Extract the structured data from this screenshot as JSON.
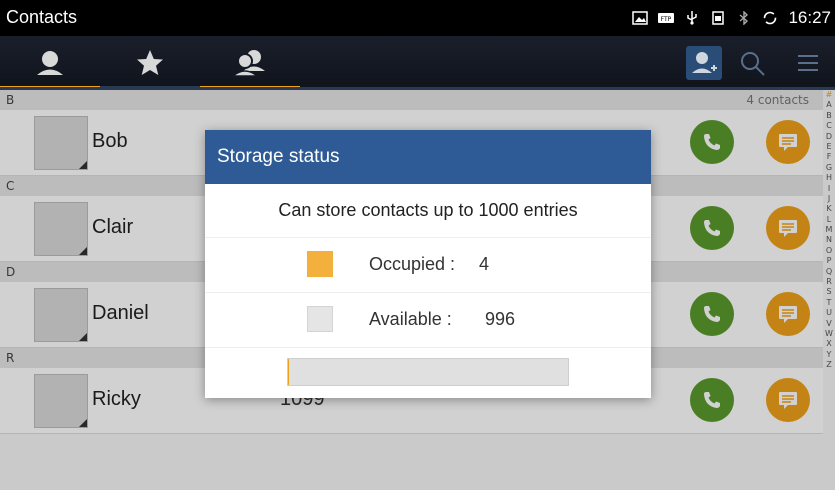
{
  "statusbar": {
    "app_title": "Contacts",
    "time": "16:27",
    "icons": [
      "image-icon",
      "ftp-icon",
      "usb-icon",
      "sim-icon",
      "bluetooth-icon",
      "sync-icon"
    ]
  },
  "tabs": [
    {
      "icon": "person-icon",
      "active": true
    },
    {
      "icon": "star-icon",
      "active": false
    },
    {
      "icon": "group-icon",
      "active": false
    }
  ],
  "toolbar_actions": [
    "add-contact-icon",
    "search-icon",
    "menu-icon"
  ],
  "contacts": {
    "count_label": "4 contacts",
    "sections": [
      {
        "letter": "B",
        "items": [
          {
            "name": "Bob",
            "number": ""
          }
        ]
      },
      {
        "letter": "C",
        "items": [
          {
            "name": "Clair",
            "number": ""
          }
        ]
      },
      {
        "letter": "D",
        "items": [
          {
            "name": "Daniel",
            "number": ""
          }
        ]
      },
      {
        "letter": "R",
        "items": [
          {
            "name": "Ricky",
            "number": "1099"
          }
        ]
      }
    ]
  },
  "alphabet": [
    "#",
    "A",
    "B",
    "C",
    "D",
    "E",
    "F",
    "G",
    "H",
    "I",
    "J",
    "K",
    "L",
    "M",
    "N",
    "O",
    "P",
    "Q",
    "R",
    "S",
    "T",
    "U",
    "V",
    "W",
    "X",
    "Y",
    "Z"
  ],
  "dialog": {
    "title": "Storage status",
    "message": "Can store contacts up to 1000 entries",
    "occupied_label": "Occupied :",
    "occupied_value": "4",
    "available_label": "Available :",
    "available_value": "996",
    "usage_fraction": 0.004,
    "colors": {
      "occupied": "#f4b03c",
      "available": "#e5e5e5",
      "header": "#2e5b95"
    }
  }
}
